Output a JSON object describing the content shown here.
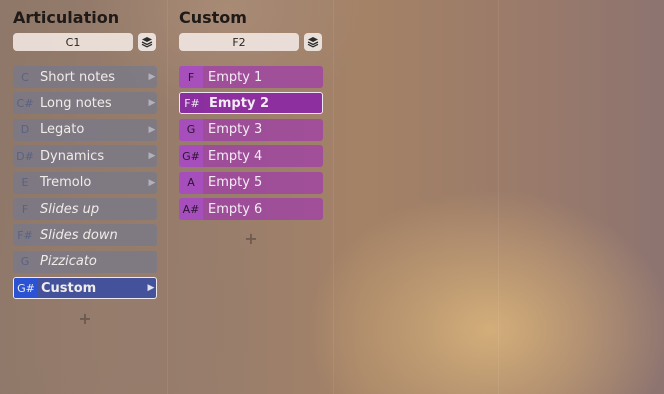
{
  "articulation": {
    "title": "Articulation",
    "key": "C1",
    "layers_icon": "layers-icon",
    "items": [
      {
        "note": "C",
        "label": "Short notes",
        "italic": false,
        "arrow": true
      },
      {
        "note": "C#",
        "label": "Long notes",
        "italic": false,
        "arrow": true
      },
      {
        "note": "D",
        "label": "Legato",
        "italic": false,
        "arrow": true
      },
      {
        "note": "D#",
        "label": "Dynamics",
        "italic": false,
        "arrow": true
      },
      {
        "note": "E",
        "label": "Tremolo",
        "italic": false,
        "arrow": true
      },
      {
        "note": "F",
        "label": "Slides up",
        "italic": true,
        "arrow": false
      },
      {
        "note": "F#",
        "label": "Slides down",
        "italic": true,
        "arrow": false
      },
      {
        "note": "G",
        "label": "Pizzicato",
        "italic": true,
        "arrow": false
      },
      {
        "note": "G#",
        "label": "Custom",
        "italic": false,
        "arrow": true
      }
    ],
    "selected_index": 8,
    "add_symbol": "+"
  },
  "custom": {
    "title": "Custom",
    "key": "F2",
    "layers_icon": "layers-icon",
    "items": [
      {
        "note": "F",
        "label": "Empty 1"
      },
      {
        "note": "F#",
        "label": "Empty 2"
      },
      {
        "note": "G",
        "label": "Empty 3"
      },
      {
        "note": "G#",
        "label": "Empty 4"
      },
      {
        "note": "A",
        "label": "Empty 5"
      },
      {
        "note": "A#",
        "label": "Empty 6"
      }
    ],
    "selected_index": 1,
    "add_symbol": "+"
  },
  "colors": {
    "articulation_row": "#6e7896",
    "articulation_selected": "#43529a",
    "articulation_selected_note": "#2a52d3",
    "custom_row": "#a03caa",
    "custom_selected": "#8d2f9e"
  }
}
